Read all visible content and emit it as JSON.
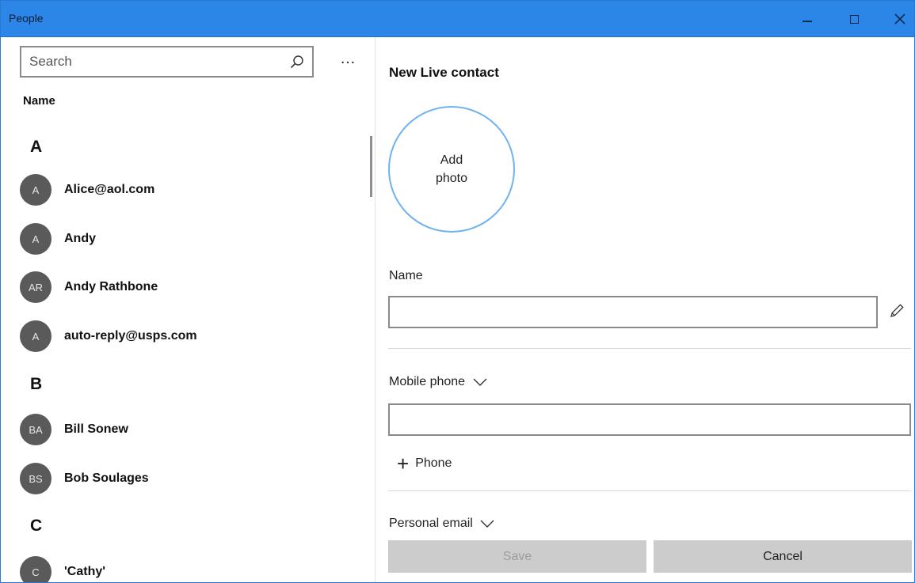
{
  "window": {
    "title": "People",
    "minimize_icon": "minimize-icon",
    "maximize_icon": "maximize-icon",
    "close_icon": "close-icon",
    "accent_color": "#2b86e8"
  },
  "left_pane": {
    "search_placeholder": "Search",
    "search_icon": "search-icon",
    "more_label": "…",
    "column_header": "Name",
    "groups": [
      {
        "letter": "A",
        "contacts": [
          {
            "initials": "A",
            "name": "Alice@aol.com"
          },
          {
            "initials": "A",
            "name": "Andy"
          },
          {
            "initials": "AR",
            "name": "Andy Rathbone"
          },
          {
            "initials": "A",
            "name": "auto-reply@usps.com"
          }
        ]
      },
      {
        "letter": "B",
        "contacts": [
          {
            "initials": "BA",
            "name": "Bill Sonew"
          },
          {
            "initials": "BS",
            "name": "Bob Soulages"
          }
        ]
      },
      {
        "letter": "C",
        "contacts": [
          {
            "initials": "C",
            "name": "'Cathy'"
          }
        ]
      }
    ]
  },
  "right_pane": {
    "heading": "New Live contact",
    "add_photo_line1": "Add",
    "add_photo_line2": "photo",
    "name_label": "Name",
    "name_value": "",
    "mobile_phone_label": "Mobile phone",
    "mobile_phone_value": "",
    "add_phone_label": "Phone",
    "personal_email_label": "Personal email",
    "save_label": "Save",
    "cancel_label": "Cancel"
  }
}
